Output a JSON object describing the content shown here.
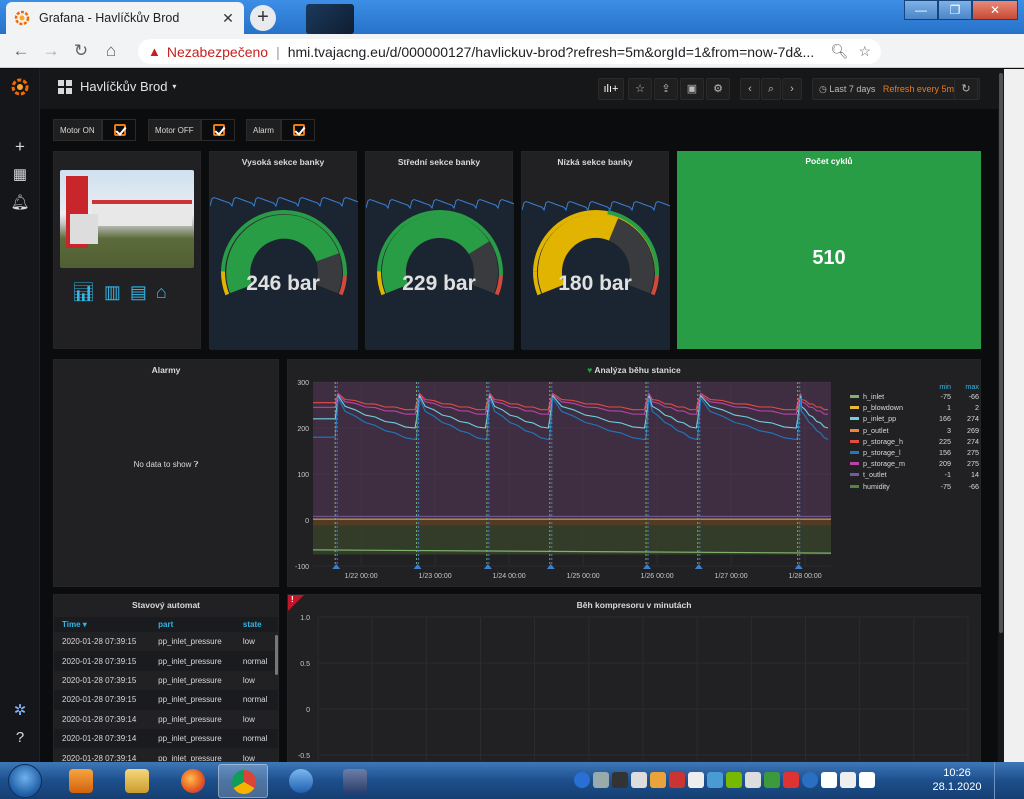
{
  "browser": {
    "tab_title": "Grafana - Havlíčkův Brod",
    "tab_close": "✕",
    "new_tab": "+",
    "security_label": "Nezabezpečeno",
    "url": "hmi.tvajacng.eu/d/000000127/havlickuv-brod?refresh=5m&orgId=1&from=now-7d&...",
    "ext_badge": "0",
    "window_controls": [
      "—",
      "❐",
      "✕"
    ]
  },
  "grafana": {
    "dashboard_title": "Havlíčkův Brod",
    "time_range": "Last 7 days",
    "refresh_label": "Refresh every 5m",
    "variables": [
      {
        "label": "Motor ON"
      },
      {
        "label": "Motor OFF"
      },
      {
        "label": "Alarm"
      }
    ],
    "gauges": [
      {
        "title": "Vysoká sekce banky",
        "value": "246 bar",
        "fraction": 0.82,
        "color": "#299c46"
      },
      {
        "title": "Střední sekce banky",
        "value": "229 bar",
        "fraction": 0.76,
        "color": "#299c46"
      },
      {
        "title": "Nízká sekce banky",
        "value": "180 bar",
        "fraction": 0.6,
        "color": "#e0b400"
      }
    ],
    "cycles": {
      "title": "Počet cyklů",
      "value": "510"
    },
    "alarms": {
      "title": "Alarmy",
      "nodata": "No data to show"
    },
    "graph": {
      "title": "Analýza běhu stanice",
      "legend_header": {
        "min": "min",
        "max": "max"
      },
      "legend": [
        {
          "name": "h_inlet",
          "min": "-75",
          "max": "-66",
          "color": "#7eb26d"
        },
        {
          "name": "p_blowdown",
          "min": "1",
          "max": "2",
          "color": "#eab839"
        },
        {
          "name": "p_inlet_pp",
          "min": "166",
          "max": "274",
          "color": "#6ed0e0"
        },
        {
          "name": "p_outlet",
          "min": "3",
          "max": "269",
          "color": "#ef843c"
        },
        {
          "name": "p_storage_h",
          "min": "225",
          "max": "274",
          "color": "#e24d42"
        },
        {
          "name": "p_storage_l",
          "min": "156",
          "max": "275",
          "color": "#1f78c1"
        },
        {
          "name": "p_storage_m",
          "min": "209",
          "max": "275",
          "color": "#ba43a9"
        },
        {
          "name": "t_outlet",
          "min": "-1",
          "max": "14",
          "color": "#705da0"
        },
        {
          "name": "humidity",
          "min": "-75",
          "max": "-66",
          "color": "#508642"
        }
      ],
      "y_ticks": [
        "300",
        "200",
        "100",
        "0",
        "-100"
      ],
      "x_ticks": [
        "1/22 00:00",
        "1/23 00:00",
        "1/24 00:00",
        "1/25 00:00",
        "1/26 00:00",
        "1/27 00:00",
        "1/28 00:00"
      ]
    },
    "state_table": {
      "title": "Stavový automat",
      "columns": [
        "Time ▾",
        "part",
        "state"
      ],
      "rows": [
        [
          "2020-01-28 07:39:15",
          "pp_inlet_pressure",
          "low"
        ],
        [
          "2020-01-28 07:39:15",
          "pp_inlet_pressure",
          "normal"
        ],
        [
          "2020-01-28 07:39:15",
          "pp_inlet_pressure",
          "low"
        ],
        [
          "2020-01-28 07:39:15",
          "pp_inlet_pressure",
          "normal"
        ],
        [
          "2020-01-28 07:39:14",
          "pp_inlet_pressure",
          "low"
        ],
        [
          "2020-01-28 07:39:14",
          "pp_inlet_pressure",
          "normal"
        ],
        [
          "2020-01-28 07:39:14",
          "pp_inlet_pressure",
          "low"
        ]
      ]
    },
    "compressor": {
      "title": "Běh kompresoru v minutách",
      "corner": "!",
      "y_ticks": [
        "1.0",
        "0.5",
        "0",
        "-0.5"
      ]
    }
  },
  "taskbar": {
    "time": "10:26",
    "date": "28.1.2020"
  }
}
